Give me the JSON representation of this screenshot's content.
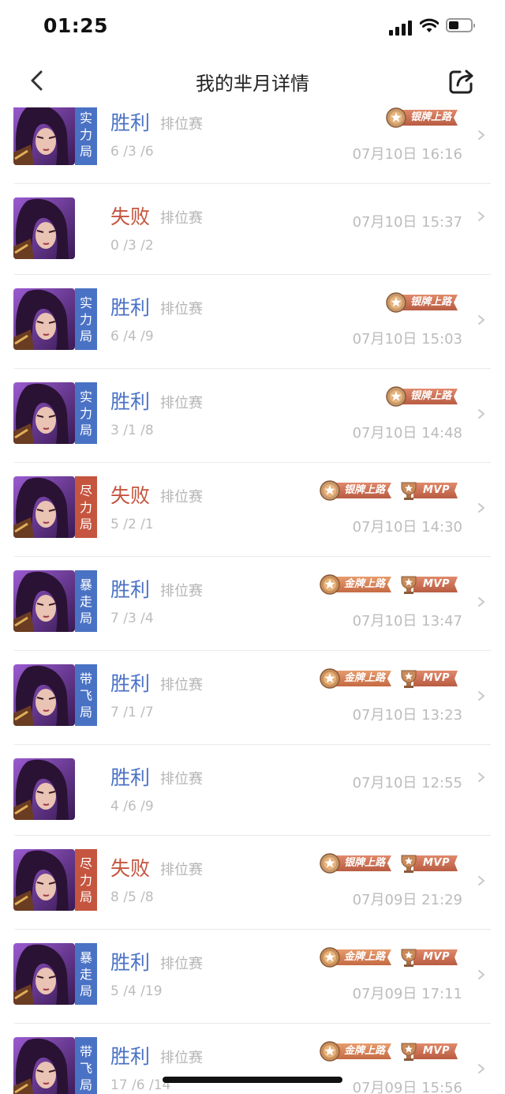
{
  "status_bar": {
    "time": "01:25"
  },
  "header": {
    "title": "我的芈月详情"
  },
  "colors": {
    "win": "#4a72c4",
    "lose": "#c5553f",
    "muted": "#bcbcbc"
  },
  "matches": [
    {
      "result": "胜利",
      "outcome": "win",
      "mode": "排位赛",
      "tag": [
        "实",
        "力",
        "局"
      ],
      "tag_color": "blue",
      "kda": "6 /3 /6",
      "datetime": "07月10日 16:16",
      "badges": [
        {
          "type": "silver",
          "label": "银牌上路"
        }
      ]
    },
    {
      "result": "失败",
      "outcome": "lose",
      "mode": "排位赛",
      "tag": [],
      "tag_color": "",
      "kda": "0 /3 /2",
      "datetime": "07月10日 15:37",
      "badges": []
    },
    {
      "result": "胜利",
      "outcome": "win",
      "mode": "排位赛",
      "tag": [
        "实",
        "力",
        "局"
      ],
      "tag_color": "blue",
      "kda": "6 /4 /9",
      "datetime": "07月10日 15:03",
      "badges": [
        {
          "type": "silver",
          "label": "银牌上路"
        }
      ]
    },
    {
      "result": "胜利",
      "outcome": "win",
      "mode": "排位赛",
      "tag": [
        "实",
        "力",
        "局"
      ],
      "tag_color": "blue",
      "kda": "3 /1 /8",
      "datetime": "07月10日 14:48",
      "badges": [
        {
          "type": "silver",
          "label": "银牌上路"
        }
      ]
    },
    {
      "result": "失败",
      "outcome": "lose",
      "mode": "排位赛",
      "tag": [
        "尽",
        "力",
        "局"
      ],
      "tag_color": "red",
      "kda": "5 /2 /1",
      "datetime": "07月10日 14:30",
      "badges": [
        {
          "type": "silver",
          "label": "银牌上路"
        },
        {
          "type": "mvp",
          "label": "MVP"
        }
      ]
    },
    {
      "result": "胜利",
      "outcome": "win",
      "mode": "排位赛",
      "tag": [
        "暴",
        "走",
        "局"
      ],
      "tag_color": "blue",
      "kda": "7 /3 /4",
      "datetime": "07月10日 13:47",
      "badges": [
        {
          "type": "gold",
          "label": "金牌上路"
        },
        {
          "type": "mvp",
          "label": "MVP"
        }
      ]
    },
    {
      "result": "胜利",
      "outcome": "win",
      "mode": "排位赛",
      "tag": [
        "带",
        "飞",
        "局"
      ],
      "tag_color": "blue",
      "kda": "7 /1 /7",
      "datetime": "07月10日 13:23",
      "badges": [
        {
          "type": "gold",
          "label": "金牌上路"
        },
        {
          "type": "mvp",
          "label": "MVP"
        }
      ]
    },
    {
      "result": "胜利",
      "outcome": "win",
      "mode": "排位赛",
      "tag": [],
      "tag_color": "",
      "kda": "4 /6 /9",
      "datetime": "07月10日 12:55",
      "badges": []
    },
    {
      "result": "失败",
      "outcome": "lose",
      "mode": "排位赛",
      "tag": [
        "尽",
        "力",
        "局"
      ],
      "tag_color": "red",
      "kda": "8 /5 /8",
      "datetime": "07月09日 21:29",
      "badges": [
        {
          "type": "silver",
          "label": "银牌上路"
        },
        {
          "type": "mvp",
          "label": "MVP"
        }
      ]
    },
    {
      "result": "胜利",
      "outcome": "win",
      "mode": "排位赛",
      "tag": [
        "暴",
        "走",
        "局"
      ],
      "tag_color": "blue",
      "kda": "5 /4 /19",
      "datetime": "07月09日 17:11",
      "badges": [
        {
          "type": "gold",
          "label": "金牌上路"
        },
        {
          "type": "mvp",
          "label": "MVP"
        }
      ]
    },
    {
      "result": "胜利",
      "outcome": "win",
      "mode": "排位赛",
      "tag": [
        "带",
        "飞",
        "局"
      ],
      "tag_color": "blue",
      "kda": "17 /6 /14",
      "datetime": "07月09日 15:56",
      "badges": [
        {
          "type": "gold",
          "label": "金牌上路"
        },
        {
          "type": "mvp",
          "label": "MVP"
        }
      ]
    }
  ]
}
